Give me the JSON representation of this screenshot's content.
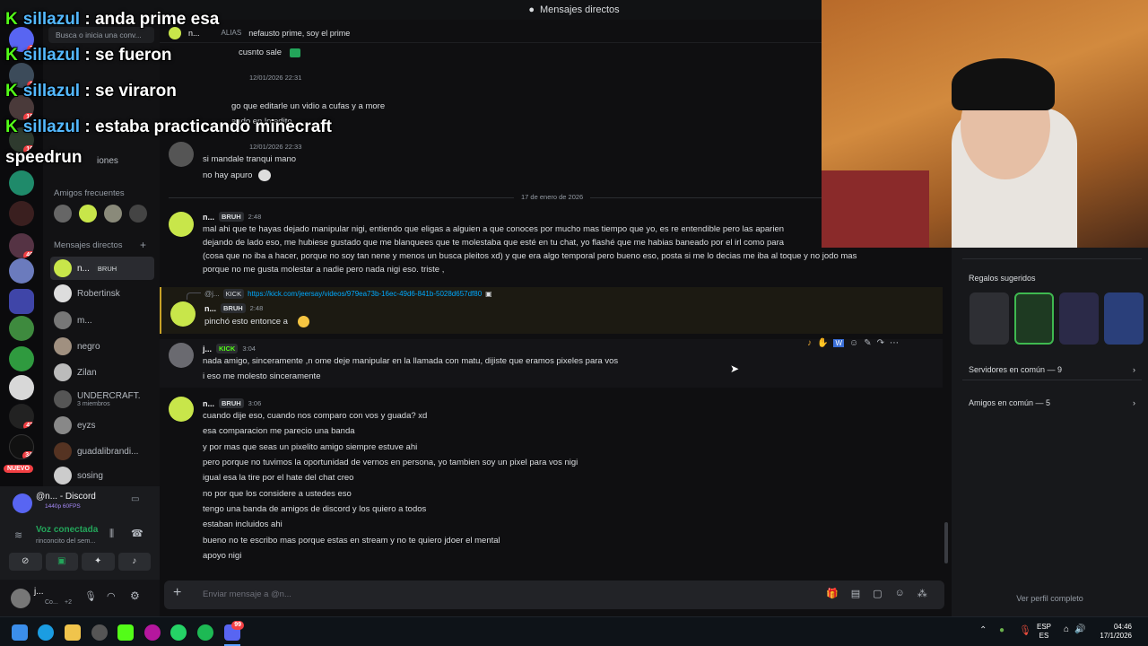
{
  "window": {
    "title": "Mensajes directos"
  },
  "search": {
    "placeholder": "Busca o inicia una conv..."
  },
  "chat_header": {
    "name": "n...",
    "alias_label": "ALIAS",
    "alias": "nefausto prime, soy el prime"
  },
  "sidebar": {
    "friends_label": "Amigos frecuentes",
    "dm_label": "Mensajes directos",
    "nitro_partial": "iones",
    "dms": [
      {
        "name": "n...",
        "tag": "BRUH",
        "active": true
      },
      {
        "name": "Robertinsk"
      },
      {
        "name": "m..."
      },
      {
        "name": "negro"
      },
      {
        "name": "Zilan"
      },
      {
        "name": "UNDERCRAFT.",
        "sub": "3 miembros"
      },
      {
        "name": "eyzs"
      },
      {
        "name": "guadalibrandi..."
      },
      {
        "name": "sosing"
      }
    ],
    "new_badge": "NUEVO"
  },
  "server_badges": [
    "7",
    "2",
    "18",
    "16",
    "40",
    "43",
    "34"
  ],
  "voice": {
    "activity_title": "@n... - Discord",
    "activity_sub": "1440p 60FPS",
    "status": "Voz conectada",
    "channel": "rinconcito del sem..."
  },
  "user_panel": {
    "name": "j...",
    "status": "Co...",
    "extra": "+2"
  },
  "messages": [
    {
      "partial": "cusnto sale"
    },
    {
      "author": "n...",
      "tag": "BRUH",
      "time": "12/01/2026 22:31",
      "lines": [
        "go que editarle un vidio a cufas y a more",
        "ando en lo edito"
      ]
    },
    {
      "time": "12/01/2026 22:33",
      "lines": [
        "si mandale tranqui mano",
        "no hay apuro"
      ]
    },
    {
      "divider": "17 de enero de 2026"
    },
    {
      "author": "n...",
      "tag": "BRUH",
      "time": "2:48",
      "lines": [
        "mal ahi que te hayas dejado manipular nigi, entiendo que eligas a alguien a que conoces por mucho mas tiempo que yo, es re entendible pero las aparien",
        "dejando de lado eso, me hubiese gustado que me blanquees que te molestaba que esté en tu chat, yo flashé que me habias baneado por el irl como para",
        "(cosa que no iba a hacer, porque no soy tan nene y menos un busca pleitos xd) y que era algo temporal pero bueno  eso, posta si me lo decias  me iba al toque y no jodo mas",
        "porque no me gusta molestar a nadie pero nada nigi eso. triste ,"
      ]
    },
    {
      "reply_author": "@j...",
      "reply_tag": "KICK",
      "reply_link": "https://kick.com/jeersay/videos/979ea73b-16ec-49d6-841b-5028d657df80",
      "author": "n...",
      "tag": "BRUH",
      "time": "2:48",
      "lines": [
        "pinchó esto entonce a"
      ]
    },
    {
      "author": "j...",
      "tag": "KICK",
      "time": "3:04",
      "lines": [
        "nada amigo, sinceramente ,n ome deje manipular en la llamada con matu, dijiste que eramos pixeles para vos",
        "i eso me molesto sinceramente"
      ]
    },
    {
      "author": "n...",
      "tag": "BRUH",
      "time": "3:06",
      "lines": [
        "cuando dije eso, cuando nos comparo con vos y guada? xd",
        "esa comparacion me parecio una banda",
        "y por mas que seas un pixelito amigo siempre estuve ahi",
        "pero porque no tuvimos la oportunidad de vernos en persona, yo tambien soy un pixel para vos nigi",
        "igual esa la tire por el hate del chat creo",
        "no por que los considere a ustedes eso",
        "tengo una banda de amigos de discord y los quiero a todos",
        "estaban incluidos ahi",
        "bueno no te escribo mas porque estas en stream y no te quiero jdoer el mental",
        "apoyo nigi"
      ]
    }
  ],
  "composer": {
    "placeholder": "Enviar mensaje a @n..."
  },
  "profile_panel": {
    "gifts_label": "Regalos sugeridos",
    "servers_common": "Servidores en común — 9",
    "friends_common": "Amigos en común — 5",
    "view_profile": "Ver perfil completo"
  },
  "overlay_chat": [
    {
      "user": "sillazul",
      "text": ": anda prime esa"
    },
    {
      "user": "sillazul",
      "text": ": se fueron"
    },
    {
      "user": "sillazul",
      "text": ": se viraron"
    },
    {
      "user": "sillazul",
      "text": ": estaba practicando minecraft"
    },
    {
      "cont": "speedrun"
    }
  ],
  "overlay_kick_glyph": "K",
  "taskbar": {
    "lang": "ESP",
    "lang_sub": "ES",
    "time": "04:46",
    "date": "17/1/2026",
    "discord_badge": "99"
  },
  "colors": {
    "accent": "#5865f2",
    "green": "#23a55a",
    "kick": "#53fc18",
    "link": "#00a8fc"
  }
}
